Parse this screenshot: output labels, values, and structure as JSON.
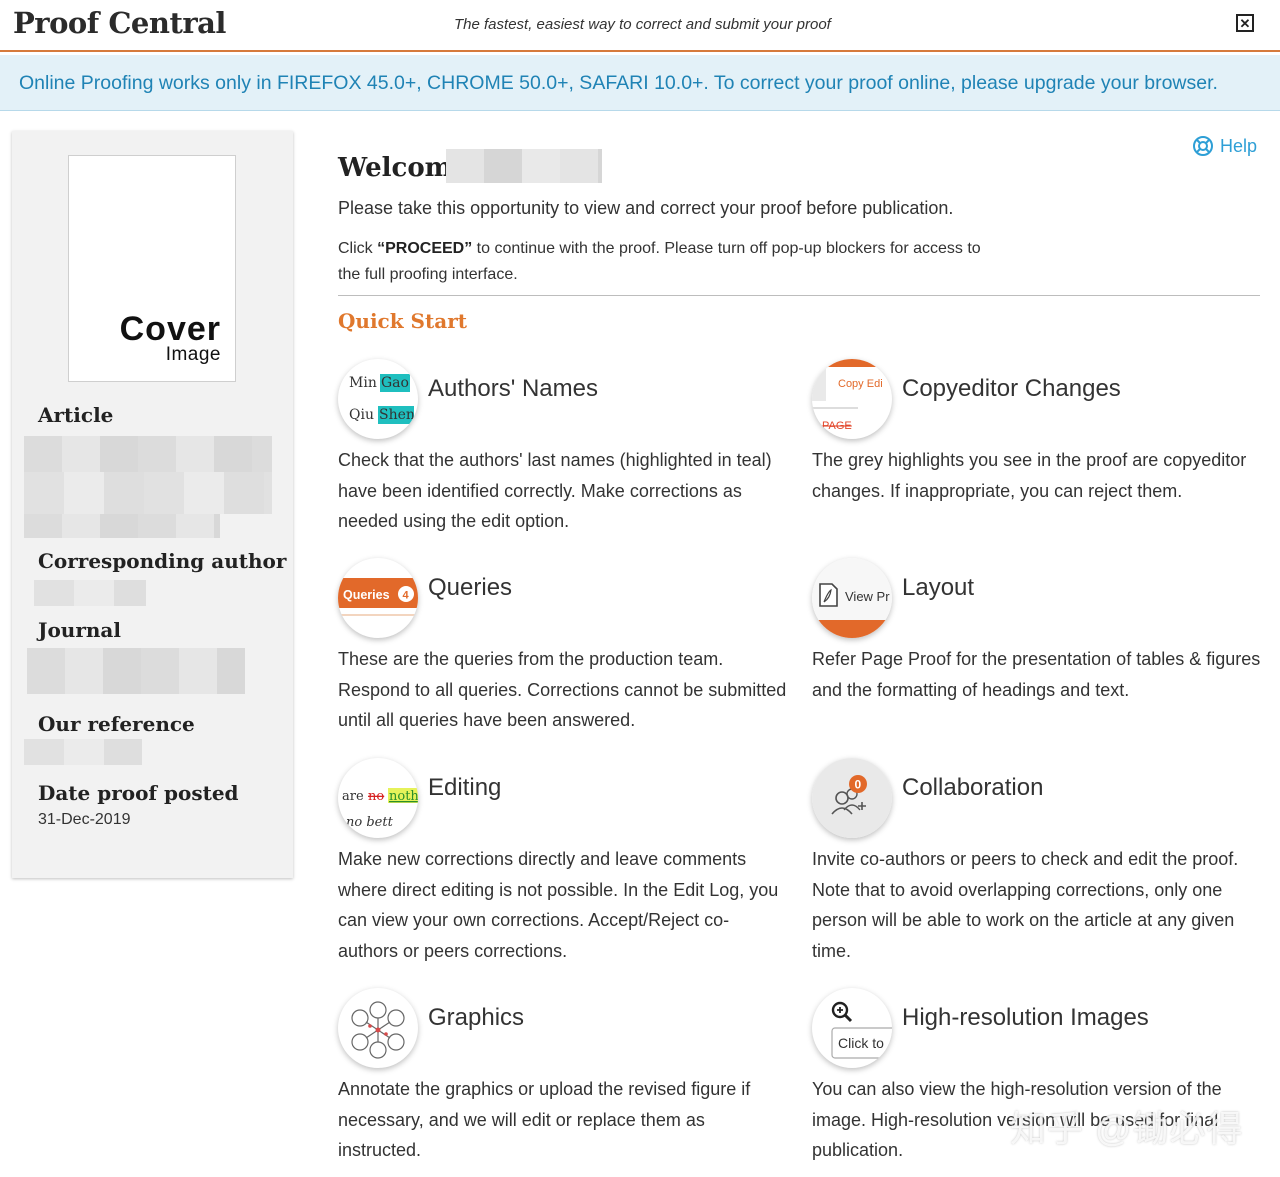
{
  "header": {
    "brand": "Proof Central",
    "tagline": "The fastest, easiest way to correct and submit your proof",
    "close_symbol": "✕"
  },
  "banner": {
    "text": "Online Proofing works only in FIREFOX 45.0+, CHROME 50.0+, SAFARI 10.0+. To correct your proof online, please upgrade your browser."
  },
  "sidebar": {
    "cover": {
      "line1": "Cover",
      "line2": "Image"
    },
    "article_label": "Article",
    "corresponding_author_label": "Corresponding author",
    "journal_label": "Journal",
    "our_reference_label": "Our reference",
    "date_label": "Date proof posted",
    "date_value": "31-Dec-2019"
  },
  "main": {
    "help_label": "Help",
    "welcome": "Welcome",
    "intro": "Please take this opportunity to view and correct your proof before publication.",
    "proceed_pre": "Click ",
    "proceed_bold": "“PROCEED”",
    "proceed_post": " to continue with the proof. Please turn off pop-up blockers for access to the full proofing interface.",
    "quick_start": "Quick Start"
  },
  "features": [
    {
      "title": "Authors' Names",
      "description": "Check that the authors' last names (highlighted in teal) have been identified correctly. Make corrections as needed using the edit option.",
      "icon_text": {
        "row1_first": "Min",
        "row1_last": "Gao",
        "row2_first": "Qiu",
        "row2_last": "Shen"
      }
    },
    {
      "title": "Copyeditor Changes",
      "description": "The grey highlights you see in the proof are copyeditor changes. If inappropriate, you can reject them.",
      "icon_text": {
        "top": "Copy Edi",
        "bottom": "PAGE"
      }
    },
    {
      "title": "Queries",
      "description": "These are the queries from the production team. Respond to all queries. Corrections cannot be submitted until all queries have been answered.",
      "icon_text": {
        "label": "Queries",
        "count": "4"
      }
    },
    {
      "title": "Layout",
      "description": "Refer Page Proof for the presentation of tables & figures and the formatting of headings and text.",
      "icon_text": {
        "label": "View Pr"
      }
    },
    {
      "title": "Editing",
      "description": "Make new corrections directly and leave comments where direct editing is not possible. In the Edit Log, you can view your own corrections. Accept/Reject co-authors or peers corrections.",
      "icon_text": {
        "w1": "are",
        "deleted": "no",
        "inserted": "noth",
        "line2": "no bett"
      }
    },
    {
      "title": "Collaboration",
      "description": "Invite co-authors or peers to check and edit the proof. Note that to avoid overlapping corrections, only one person will be able to work on the article at any given time.",
      "icon_text": {
        "badge": "0"
      }
    },
    {
      "title": "Graphics",
      "description": "Annotate the graphics or upload the revised figure if necessary, and we will edit or replace them as instructed.",
      "icon_text": {}
    },
    {
      "title": "High-resolution Images",
      "description": "You can also view the high-resolution version of the image. High-resolution version will be used for final publication.",
      "icon_text": {
        "label": "Click to"
      }
    }
  ],
  "watermark": "知乎 @锄必得",
  "colors": {
    "accent_orange": "#e0782d",
    "banner_text": "#1f83b5",
    "banner_bg": "#e3f1f8",
    "teal_highlight": "#1fbfbf",
    "help_blue": "#2e9fd6"
  },
  "icons": [
    "close-icon",
    "help-lifebuoy-icon",
    "authors-names-icon",
    "copyeditor-changes-icon",
    "queries-icon",
    "layout-pdf-icon",
    "editing-icon",
    "collaboration-icon",
    "graphics-icon",
    "zoom-in-icon"
  ]
}
